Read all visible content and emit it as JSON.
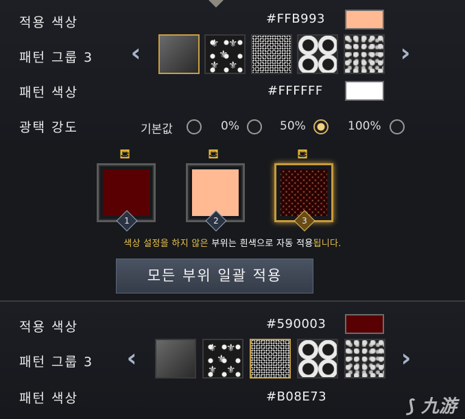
{
  "top": {
    "apply_color_label": "적용 색상",
    "apply_color_hex": "#FFB993",
    "apply_color_value": "#FFB993",
    "pattern_group_label": "패턴 그룹 3",
    "pattern_color_label": "패턴 색상",
    "pattern_color_hex": "#FFFFFF",
    "pattern_color_value": "#FFFFFF",
    "gloss_label": "광택 강도",
    "gloss_options": [
      "기본값",
      "0%",
      "50%",
      "100%"
    ],
    "gloss_selected": "50%"
  },
  "slots": {
    "numbers": [
      "1",
      "2",
      "3"
    ],
    "colors": [
      "#590003",
      "#FFB993",
      "#B08E73"
    ],
    "selected": "3"
  },
  "notice": {
    "part1": "색상 설정을 하지 않은 ",
    "part2": "부위는 ",
    "part3": "흰색으로 자동 적용",
    "part4": "됩니다."
  },
  "apply_all_button": "모든 부위 일괄 적용",
  "bottom": {
    "apply_color_label": "적용 색상",
    "apply_color_hex": "#590003",
    "apply_color_value": "#590003",
    "pattern_group_label": "패턴 그룹 3",
    "pattern_color_label": "패턴 색상",
    "pattern_color_hex": "#B08E73"
  },
  "icons": {
    "prev": "chevron-left-icon",
    "next": "chevron-right-icon",
    "bucket": "paint-bucket-icon"
  },
  "watermark": "九游"
}
